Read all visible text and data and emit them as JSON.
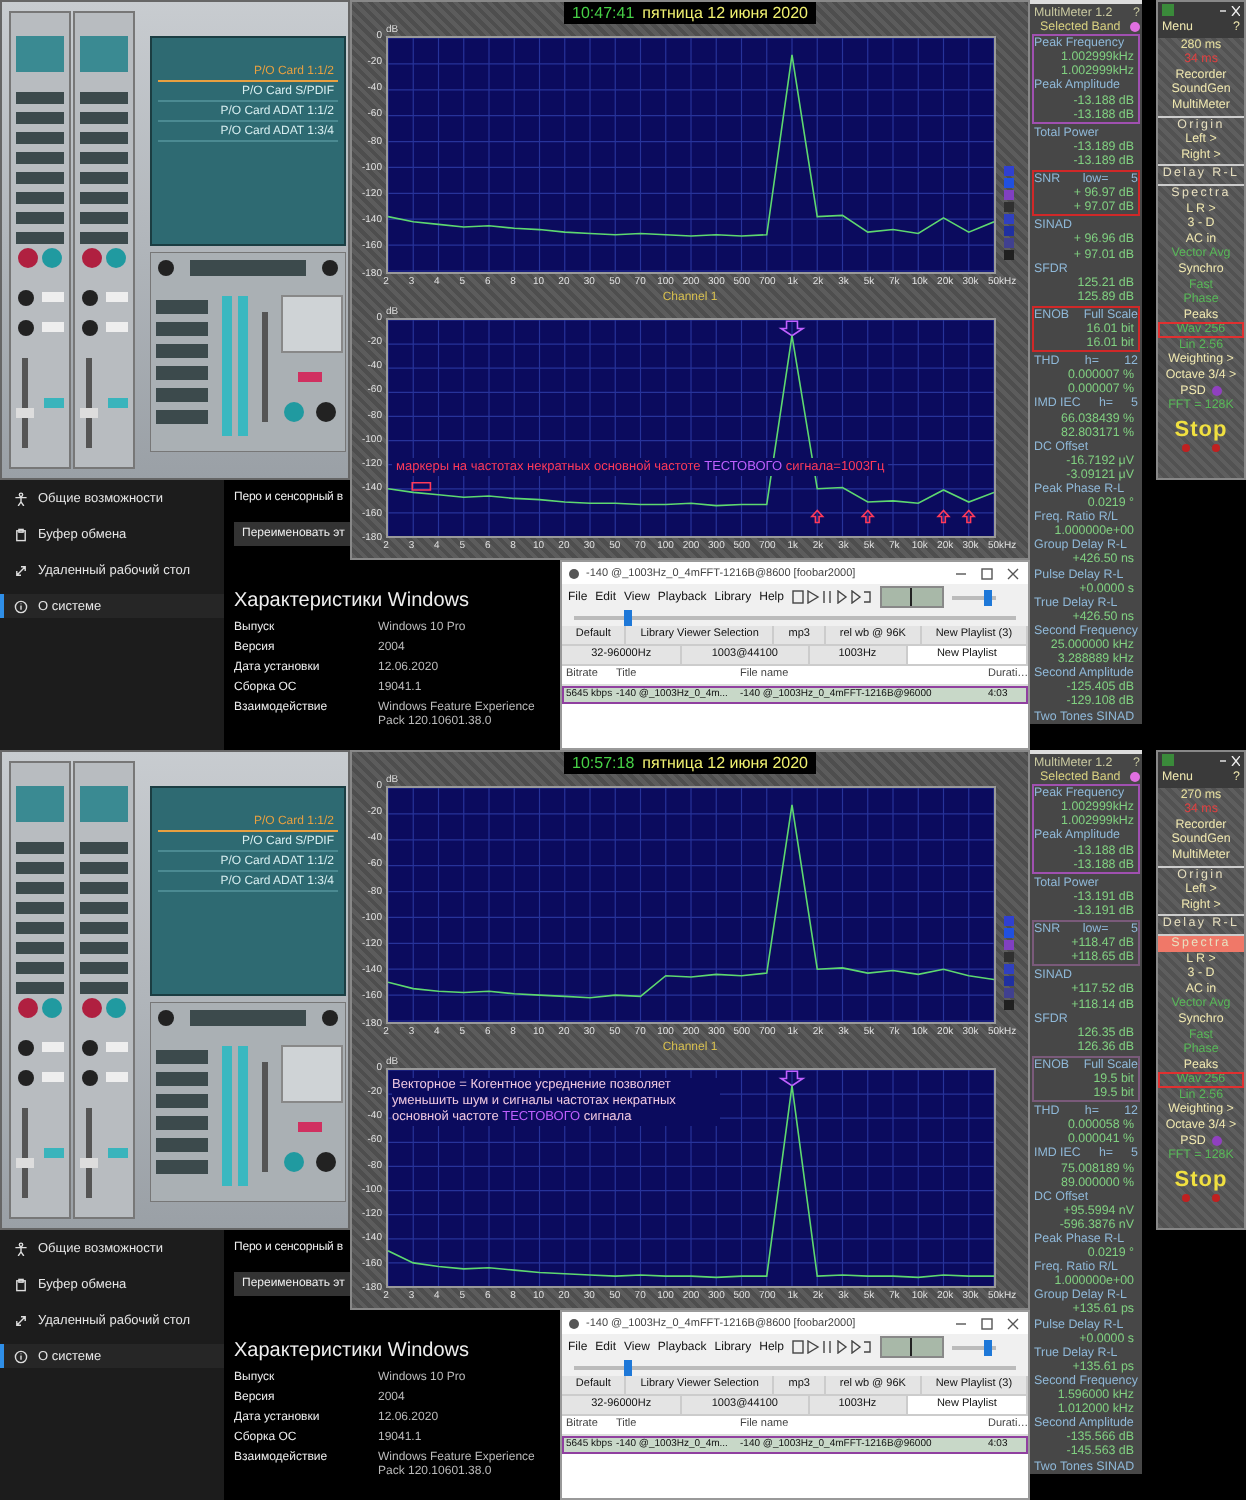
{
  "halves": [
    {
      "mixer": {
        "outputs": [
          {
            "label": "P/O Card 1:1/2",
            "selected": true
          },
          {
            "label": "P/O Card S/PDIF",
            "selected": false
          },
          {
            "label": "P/O Card ADAT 1:1/2",
            "selected": false
          },
          {
            "label": "P/O Card ADAT 1:3/4",
            "selected": false
          }
        ]
      },
      "analyzer": {
        "clock": "10:47:41",
        "date": "пятница 12 июня 2020",
        "charts": [
          {
            "chart_data": {
              "type": "line",
              "xlabel": "Hz",
              "ylabel": "dB",
              "ylim": [
                -180,
                0
              ],
              "grid": true,
              "categories": [
                "2",
                "3",
                "4",
                "5",
                "6",
                "8",
                "10",
                "20",
                "30",
                "50",
                "70",
                "100",
                "200",
                "300",
                "500",
                "700",
                "1k",
                "2k",
                "3k",
                "5k",
                "7k",
                "10k",
                "20k",
                "30k",
                "50k"
              ],
              "series": [
                {
                  "color": "#5ed870",
                  "values": [
                    -138,
                    -142,
                    -144,
                    -146,
                    -145,
                    -147,
                    -148,
                    -150,
                    -151,
                    -152,
                    -151,
                    -152,
                    -153,
                    -152,
                    -153,
                    -152,
                    -13,
                    -138,
                    -137,
                    -150,
                    -148,
                    -151,
                    -139,
                    -150,
                    -142
                  ]
                }
              ],
              "yticks": [
                0,
                -20,
                -40,
                -60,
                -80,
                -100,
                -120,
                -140,
                -160,
                -180
              ]
            }
          },
          {
            "chart_data": {
              "type": "line",
              "title": "Channel 1",
              "xlabel": "Hz",
              "ylabel": "dB",
              "ylim": [
                -180,
                0
              ],
              "grid": true,
              "categories": [
                "2",
                "3",
                "4",
                "5",
                "6",
                "8",
                "10",
                "20",
                "30",
                "50",
                "70",
                "100",
                "200",
                "300",
                "500",
                "700",
                "1k",
                "2k",
                "3k",
                "5k",
                "7k",
                "10k",
                "20k",
                "30k",
                "50k"
              ],
              "series": [
                {
                  "color": "#5ed870",
                  "values": [
                    -140,
                    -143,
                    -145,
                    -147,
                    -146,
                    -148,
                    -149,
                    -151,
                    -152,
                    -152,
                    -153,
                    -153,
                    -152,
                    -154,
                    -153,
                    -153,
                    -13,
                    -140,
                    -139,
                    -151,
                    -150,
                    -152,
                    -141,
                    -151,
                    -143
                  ]
                }
              ],
              "yticks": [
                0,
                -20,
                -40,
                -60,
                -80,
                -100,
                -120,
                -140,
                -160,
                -180
              ]
            }
          }
        ],
        "annotation": {
          "kind": "markers",
          "parts": [
            {
              "text": "маркеры на частотах некратных основной частоте",
              "color": "#ff3a5a"
            },
            {
              "text": "ТЕСТОВОГО",
              "color": "#c060ff"
            },
            {
              "text": "сигнала=1003Гц",
              "color": "#ff3a5a"
            }
          ]
        }
      },
      "settings": {
        "sidebar": [
          {
            "kind": "accessibility",
            "label": "Общие возможности",
            "selected": false
          },
          {
            "kind": "clipboard",
            "label": "Буфер обмена",
            "selected": false
          },
          {
            "kind": "remote",
            "label": "Удаленный рабочий стол",
            "selected": false
          },
          {
            "kind": "about",
            "label": "О системе",
            "selected": true
          }
        ],
        "pen_text": "Перо и сенсорный в",
        "rename_button": "Переименовать эт",
        "spec_title": "Характеристики Windows",
        "specs": [
          {
            "name": "Выпуск",
            "value": "Windows 10 Pro"
          },
          {
            "name": "Версия",
            "value": "2004"
          },
          {
            "name": "Дата установки",
            "value": "12.06.2020"
          },
          {
            "name": "Сборка ОС",
            "value": "19041.1"
          },
          {
            "name": "Взаимодействие",
            "value": "Windows Feature Experience Pack 120.10601.38.0"
          }
        ]
      },
      "player": {
        "title": "-140 @_1003Hz_0_4mFFT-1216B@8600 [foobar2000]",
        "menu": [
          "File",
          "Edit",
          "View",
          "Playback",
          "Library",
          "Help"
        ],
        "seek": {
          "level": 0.12
        },
        "volume": {
          "level": 0.8
        },
        "tabs_row1": [
          {
            "label": "Default",
            "selected": false
          },
          {
            "label": "Library Viewer Selection",
            "selected": false
          },
          {
            "label": "mp3",
            "selected": false
          },
          {
            "label": "rel wb @ 96K",
            "selected": false
          },
          {
            "label": "New Playlist (3)",
            "selected": false
          }
        ],
        "tabs_row2": [
          {
            "label": "32-96000Hz",
            "selected": false
          },
          {
            "label": "1003@44100",
            "selected": false
          },
          {
            "label": "1003Hz",
            "selected": false
          },
          {
            "label": "New Playlist",
            "selected": true
          }
        ],
        "columns": [
          "Bitrate",
          "Title",
          "File name",
          "Durati…"
        ],
        "rows": [
          {
            "cells": [
              "5645 kbps",
              "-140 @_1003Hz_0_4m...",
              "-140 @_1003Hz_0_4mFFT-1216B@96000",
              "4:03"
            ],
            "framed": true
          }
        ]
      },
      "multimeter": {
        "title": "MultiMeter 1.2",
        "help": "?",
        "band_label": "Selected Band",
        "band_dot": {
          "color": "#e070e0"
        },
        "groups": [
          {
            "color": "#a050b0",
            "rows": [
              {
                "label": "Peak Frequency",
                "values": [
                  "1.002999kHz",
                  "1.002999kHz"
                ]
              },
              {
                "label": "Peak Amplitude",
                "values": [
                  "-13.188 dB",
                  "-13.188 dB"
                ]
              }
            ]
          },
          {
            "rows": [
              {
                "label": "Total Power",
                "values": [
                  "-13.189 dB",
                  "-13.189 dB"
                ]
              }
            ]
          },
          {
            "color": "#d02828",
            "rows": [
              {
                "label": "SNR",
                "param": "low=",
                "param_value": "5",
                "values": [
                  "+ 96.97 dB",
                  "+ 97.07 dB"
                ]
              }
            ]
          },
          {
            "rows": [
              {
                "label": "SINAD",
                "values": [
                  "+ 96.96 dB",
                  "+ 97.01 dB"
                ]
              },
              {
                "label": "SFDR",
                "values": [
                  "125.21 dB",
                  "125.89 dB"
                ]
              }
            ]
          },
          {
            "color": "#d02828",
            "rows": [
              {
                "label": "ENOB",
                "param": "Full Scale",
                "values": [
                  "16.01 bit",
                  "16.01 bit"
                ]
              }
            ]
          },
          {
            "rows": [
              {
                "label": "THD",
                "param": "h=",
                "param_value": "12",
                "values": [
                  "0.000007 %",
                  "0.000007 %"
                ]
              },
              {
                "label": "IMD IEC",
                "param": "h=",
                "param_value": "5",
                "values": [
                  "66.038439 %",
                  "82.803171 %"
                ]
              },
              {
                "label": "DC Offset",
                "values": [
                  "-16.7192 μV",
                  "-3.09121 μV"
                ]
              },
              {
                "label": "Peak Phase R-L",
                "values": [
                  "0.0219 °"
                ]
              },
              {
                "label": "Freq. Ratio R/L",
                "values": [
                  "1.000000e+00"
                ]
              },
              {
                "label": "Group Delay R-L",
                "values": [
                  "+426.50 ns"
                ]
              },
              {
                "label": "Pulse Delay R-L",
                "values": [
                  "+0.0000 s"
                ]
              },
              {
                "label": "True Delay R-L",
                "values": [
                  "+426.50 ns"
                ]
              },
              {
                "label": "Second Frequency",
                "values": [
                  "25.000000 kHz",
                  "3.288889 kHz"
                ]
              },
              {
                "label": "Second Amplitude",
                "values": [
                  "-125.405 dB",
                  "-129.108 dB"
                ]
              },
              {
                "label": "Two Tones SINAD",
                "values": []
              }
            ]
          }
        ]
      },
      "menu": {
        "title": "Menu",
        "help": "?",
        "items": [
          {
            "kind": "value",
            "text": "280",
            "unit": "ms",
            "highlighted": false,
            "framed": false
          },
          {
            "kind": "alert",
            "text": "34",
            "unit": "ms",
            "highlighted": false,
            "framed": false
          },
          {
            "kind": "item",
            "text": "Recorder",
            "highlighted": false,
            "framed": false
          },
          {
            "kind": "item",
            "text": "SoundGen",
            "highlighted": false,
            "framed": false
          },
          {
            "kind": "item",
            "text": "MultiMeter",
            "highlighted": false,
            "framed": false
          },
          {
            "kind": "section",
            "text": "Origin",
            "highlighted": false,
            "framed": false
          },
          {
            "kind": "item",
            "text": "Left",
            "unit": ">",
            "highlighted": false,
            "framed": false
          },
          {
            "kind": "item",
            "text": "Right",
            "unit": ">",
            "highlighted": false,
            "framed": false
          },
          {
            "kind": "section",
            "text": "Delay R-L",
            "highlighted": false,
            "framed": false
          },
          {
            "kind": "section",
            "text": "Spectra",
            "highlighted": false,
            "framed": false
          },
          {
            "kind": "item",
            "text": "L R",
            "unit": ">",
            "highlighted": false,
            "framed": false
          },
          {
            "kind": "item",
            "text": "3 - D",
            "highlighted": false,
            "framed": false
          },
          {
            "kind": "item",
            "text": "AC in",
            "highlighted": false,
            "framed": false
          },
          {
            "kind": "dim",
            "text": "Vector Avg",
            "highlighted": false,
            "framed": false
          },
          {
            "kind": "item",
            "text": "Synchro",
            "highlighted": false,
            "framed": false
          },
          {
            "kind": "dim",
            "text": "Fast",
            "highlighted": false,
            "framed": false
          },
          {
            "kind": "dim",
            "text": "Phase",
            "highlighted": false,
            "framed": false
          },
          {
            "kind": "item",
            "text": "Peaks",
            "highlighted": false,
            "framed": false
          },
          {
            "kind": "dim",
            "text": "Wav",
            "unit": "256",
            "highlighted": false,
            "framed": true
          },
          {
            "kind": "dim",
            "text": "Lin",
            "unit": "2.56",
            "highlighted": false,
            "framed": false
          },
          {
            "kind": "item",
            "text": "Weighting",
            "unit": ">",
            "highlighted": false,
            "framed": false
          },
          {
            "kind": "item",
            "text": "Octave 3/4",
            "unit": ">",
            "highlighted": false,
            "framed": false
          },
          {
            "kind": "dot",
            "text": "PSD",
            "highlighted": false,
            "framed": false
          },
          {
            "kind": "dim",
            "text": "FFT = 128K",
            "highlighted": false,
            "framed": false
          },
          {
            "kind": "stop",
            "text": "Stop",
            "highlighted": false,
            "framed": false
          }
        ]
      }
    },
    {
      "mixer": {
        "outputs": [
          {
            "label": "P/O Card 1:1/2",
            "selected": true
          },
          {
            "label": "P/O Card S/PDIF",
            "selected": false
          },
          {
            "label": "P/O Card ADAT 1:1/2",
            "selected": false
          },
          {
            "label": "P/O Card ADAT 1:3/4",
            "selected": false
          }
        ]
      },
      "analyzer": {
        "clock": "10:57:18",
        "date": "пятница 12 июня 2020",
        "charts": [
          {
            "chart_data": {
              "type": "line",
              "xlabel": "Hz",
              "ylabel": "dB",
              "ylim": [
                -180,
                0
              ],
              "grid": true,
              "categories": [
                "2",
                "3",
                "4",
                "5",
                "6",
                "8",
                "10",
                "20",
                "30",
                "50",
                "70",
                "100",
                "200",
                "300",
                "500",
                "700",
                "1k",
                "2k",
                "3k",
                "5k",
                "7k",
                "10k",
                "20k",
                "30k",
                "50k"
              ],
              "series": [
                {
                  "color": "#5ed870",
                  "values": [
                    -150,
                    -155,
                    -157,
                    -158,
                    -157,
                    -159,
                    -160,
                    -161,
                    -162,
                    -160,
                    -161,
                    -145,
                    -146,
                    -144,
                    -145,
                    -143,
                    -13,
                    -140,
                    -139,
                    -143,
                    -141,
                    -144,
                    -140,
                    -145,
                    -148
                  ]
                }
              ],
              "yticks": [
                0,
                -20,
                -40,
                -60,
                -80,
                -100,
                -120,
                -140,
                -160,
                -180
              ]
            }
          },
          {
            "chart_data": {
              "type": "line",
              "title": "Channel 1",
              "xlabel": "Hz",
              "ylabel": "dB",
              "ylim": [
                -180,
                0
              ],
              "grid": true,
              "categories": [
                "2",
                "3",
                "4",
                "5",
                "6",
                "8",
                "10",
                "20",
                "30",
                "50",
                "70",
                "100",
                "200",
                "300",
                "500",
                "700",
                "1k",
                "2k",
                "3k",
                "5k",
                "7k",
                "10k",
                "20k",
                "30k",
                "50k"
              ],
              "series": [
                {
                  "color": "#5ed870",
                  "values": [
                    -150,
                    -160,
                    -163,
                    -165,
                    -164,
                    -166,
                    -168,
                    -169,
                    -170,
                    -171,
                    -170,
                    -171,
                    -171,
                    -172,
                    -171,
                    -171,
                    -13,
                    -171,
                    -170,
                    -171,
                    -171,
                    -172,
                    -170,
                    -171,
                    -171
                  ]
                }
              ],
              "yticks": [
                0,
                -20,
                -40,
                -60,
                -80,
                -100,
                -120,
                -140,
                -160,
                -180
              ]
            }
          }
        ],
        "annotation": {
          "kind": "note",
          "parts": [
            {
              "text": "Векторное = Когентное усреднение позволяет уменьшить шум и сигналы частотах некратных основной частоте",
              "color": "#f0c8e0"
            },
            {
              "text": "ТЕСТОВОГО",
              "color": "#c060ff"
            },
            {
              "text": "сигнала",
              "color": "#f0c8e0"
            }
          ]
        }
      },
      "settings": {
        "sidebar": [
          {
            "kind": "accessibility",
            "label": "Общие возможности",
            "selected": false
          },
          {
            "kind": "clipboard",
            "label": "Буфер обмена",
            "selected": false
          },
          {
            "kind": "remote",
            "label": "Удаленный рабочий стол",
            "selected": false
          },
          {
            "kind": "about",
            "label": "О системе",
            "selected": true
          }
        ],
        "pen_text": "Перо и сенсорный в",
        "rename_button": "Переименовать эт",
        "spec_title": "Характеристики Windows",
        "specs": [
          {
            "name": "Выпуск",
            "value": "Windows 10 Pro"
          },
          {
            "name": "Версия",
            "value": "2004"
          },
          {
            "name": "Дата установки",
            "value": "12.06.2020"
          },
          {
            "name": "Сборка ОС",
            "value": "19041.1"
          },
          {
            "name": "Взаимодействие",
            "value": "Windows Feature Experience Pack 120.10601.38.0"
          }
        ]
      },
      "player": {
        "title": "-140 @_1003Hz_0_4mFFT-1216B@8600 [foobar2000]",
        "menu": [
          "File",
          "Edit",
          "View",
          "Playback",
          "Library",
          "Help"
        ],
        "seek": {
          "level": 0.12
        },
        "volume": {
          "level": 0.8
        },
        "tabs_row1": [
          {
            "label": "Default",
            "selected": false
          },
          {
            "label": "Library Viewer Selection",
            "selected": false
          },
          {
            "label": "mp3",
            "selected": false
          },
          {
            "label": "rel wb @ 96K",
            "selected": false
          },
          {
            "label": "New Playlist (3)",
            "selected": false
          }
        ],
        "tabs_row2": [
          {
            "label": "32-96000Hz",
            "selected": false
          },
          {
            "label": "1003@44100",
            "selected": false
          },
          {
            "label": "1003Hz",
            "selected": false
          },
          {
            "label": "New Playlist",
            "selected": true
          }
        ],
        "columns": [
          "Bitrate",
          "Title",
          "File name",
          "Durati…"
        ],
        "rows": [
          {
            "cells": [
              "5645 kbps",
              "-140 @_1003Hz_0_4m...",
              "-140 @_1003Hz_0_4mFFT-1216B@96000",
              "4:03"
            ],
            "framed": true
          }
        ]
      },
      "multimeter": {
        "title": "MultiMeter 1.2",
        "help": "?",
        "band_label": "Selected Band",
        "band_dot": {
          "color": "#e070e0"
        },
        "groups": [
          {
            "color": "#a050b0",
            "rows": [
              {
                "label": "Peak Frequency",
                "values": [
                  "1.002999kHz",
                  "1.002999kHz"
                ]
              },
              {
                "label": "Peak Amplitude",
                "values": [
                  "-13.188 dB",
                  "-13.188 dB"
                ]
              }
            ]
          },
          {
            "rows": [
              {
                "label": "Total Power",
                "values": [
                  "-13.191 dB",
                  "-13.191 dB"
                ]
              }
            ]
          },
          {
            "color": "#7a5a7a",
            "rows": [
              {
                "label": "SNR",
                "param": "low=",
                "param_value": "5",
                "values": [
                  "+118.47 dB",
                  "+118.65 dB"
                ]
              }
            ]
          },
          {
            "rows": [
              {
                "label": "SINAD",
                "values": [
                  "+117.52 dB",
                  "+118.14 dB"
                ]
              },
              {
                "label": "SFDR",
                "values": [
                  "126.35 dB",
                  "126.36 dB"
                ]
              }
            ]
          },
          {
            "color": "#7a5a7a",
            "rows": [
              {
                "label": "ENOB",
                "param": "Full Scale",
                "values": [
                  "19.5 bit",
                  "19.5 bit"
                ]
              }
            ]
          },
          {
            "rows": [
              {
                "label": "THD",
                "param": "h=",
                "param_value": "12",
                "values": [
                  "0.000058 %",
                  "0.000041 %"
                ]
              },
              {
                "label": "IMD IEC",
                "param": "h=",
                "param_value": "5",
                "values": [
                  "75.008189 %",
                  "89.000000 %"
                ]
              },
              {
                "label": "DC Offset",
                "values": [
                  "+95.5994 nV",
                  "-596.3876 nV"
                ]
              },
              {
                "label": "Peak Phase R-L",
                "values": [
                  "0.0219 °"
                ]
              },
              {
                "label": "Freq. Ratio R/L",
                "values": [
                  "1.000000e+00"
                ]
              },
              {
                "label": "Group Delay R-L",
                "values": [
                  "+135.61 ps"
                ]
              },
              {
                "label": "Pulse Delay R-L",
                "values": [
                  "+0.0000 s"
                ]
              },
              {
                "label": "True Delay R-L",
                "values": [
                  "+135.61 ps"
                ]
              },
              {
                "label": "Second Frequency",
                "values": [
                  "1.596000 kHz",
                  "1.012000 kHz"
                ]
              },
              {
                "label": "Second Amplitude",
                "values": [
                  "-135.566 dB",
                  "-145.563 dB"
                ]
              },
              {
                "label": "Two Tones SINAD",
                "values": []
              }
            ]
          }
        ]
      },
      "menu": {
        "title": "Menu",
        "help": "?",
        "items": [
          {
            "kind": "value",
            "text": "270",
            "unit": "ms",
            "highlighted": false,
            "framed": false
          },
          {
            "kind": "alert",
            "text": "34",
            "unit": "ms",
            "highlighted": false,
            "framed": false
          },
          {
            "kind": "item",
            "text": "Recorder",
            "highlighted": false,
            "framed": false
          },
          {
            "kind": "item",
            "text": "SoundGen",
            "highlighted": false,
            "framed": false
          },
          {
            "kind": "item",
            "text": "MultiMeter",
            "highlighted": false,
            "framed": false
          },
          {
            "kind": "section",
            "text": "Origin",
            "highlighted": false,
            "framed": false
          },
          {
            "kind": "item",
            "text": "Left",
            "unit": ">",
            "highlighted": false,
            "framed": false
          },
          {
            "kind": "item",
            "text": "Right",
            "unit": ">",
            "highlighted": false,
            "framed": false
          },
          {
            "kind": "section",
            "text": "Delay R-L",
            "highlighted": false,
            "framed": false
          },
          {
            "kind": "section",
            "text": "Spectra",
            "highlighted": true,
            "framed": false
          },
          {
            "kind": "item",
            "text": "L R",
            "unit": ">",
            "highlighted": false,
            "framed": false
          },
          {
            "kind": "item",
            "text": "3 - D",
            "highlighted": false,
            "framed": false
          },
          {
            "kind": "item",
            "text": "AC in",
            "highlighted": false,
            "framed": false
          },
          {
            "kind": "dim",
            "text": "Vector Avg",
            "highlighted": false,
            "framed": false
          },
          {
            "kind": "item",
            "text": "Synchro",
            "highlighted": false,
            "framed": false
          },
          {
            "kind": "dim",
            "text": "Fast",
            "highlighted": false,
            "framed": false
          },
          {
            "kind": "dim",
            "text": "Phase",
            "highlighted": false,
            "framed": false
          },
          {
            "kind": "item",
            "text": "Peaks",
            "highlighted": false,
            "framed": false
          },
          {
            "kind": "dim",
            "text": "Wav",
            "unit": "256",
            "highlighted": false,
            "framed": true
          },
          {
            "kind": "dim",
            "text": "Lin",
            "unit": "2.56",
            "highlighted": false,
            "framed": false
          },
          {
            "kind": "item",
            "text": "Weighting",
            "unit": ">",
            "highlighted": false,
            "framed": false
          },
          {
            "kind": "item",
            "text": "Octave 3/4",
            "unit": ">",
            "highlighted": false,
            "framed": false
          },
          {
            "kind": "dot",
            "text": "PSD",
            "highlighted": false,
            "framed": false
          },
          {
            "kind": "dim",
            "text": "FFT = 128K",
            "highlighted": false,
            "framed": false
          },
          {
            "kind": "stop",
            "text": "Stop",
            "highlighted": false,
            "framed": false
          }
        ]
      }
    }
  ]
}
